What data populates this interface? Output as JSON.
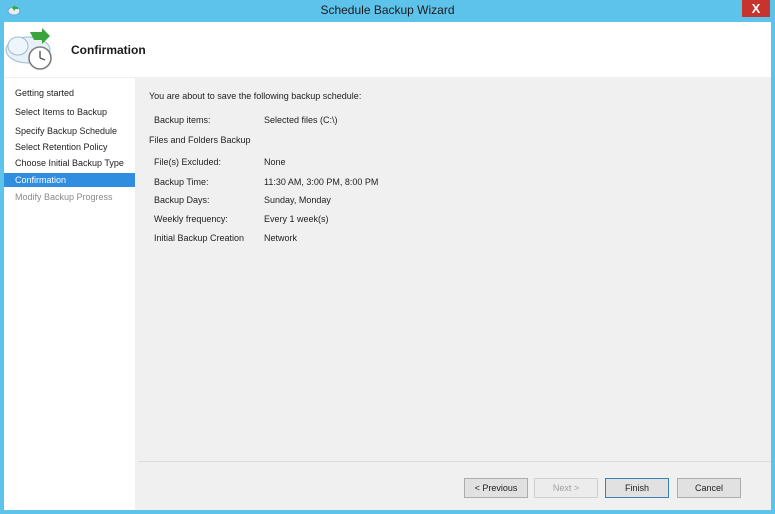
{
  "window": {
    "title": "Schedule Backup Wizard",
    "close_label": "X"
  },
  "header": {
    "title": "Confirmation"
  },
  "sidebar": {
    "items": [
      {
        "label": "Getting started",
        "state": "normal"
      },
      {
        "label": "Select Items to Backup",
        "state": "normal"
      },
      {
        "label": "Specify Backup Schedule",
        "state": "normal"
      },
      {
        "label": "Select Retention Policy",
        "state": "normal"
      },
      {
        "label": "Choose Initial Backup Type",
        "state": "normal"
      },
      {
        "label": "Confirmation",
        "state": "active"
      },
      {
        "label": "Modify Backup Progress",
        "state": "disabled"
      }
    ]
  },
  "main": {
    "intro": "You are about to save the following backup schedule:",
    "backup_items": {
      "label": "Backup items:",
      "value": "Selected files (C:\\)"
    },
    "section_title": "Files and Folders Backup",
    "details": [
      {
        "label": "File(s) Excluded:",
        "value": "None"
      },
      {
        "label": "Backup Time:",
        "value": "11:30 AM, 3:00 PM, 8:00 PM"
      },
      {
        "label": "Backup Days:",
        "value": "Sunday, Monday"
      },
      {
        "label": "Weekly frequency:",
        "value": "Every 1 week(s)"
      },
      {
        "label": "Initial Backup Creation",
        "value": "Network"
      }
    ]
  },
  "footer": {
    "previous_label": "< Previous",
    "next_label": "Next >",
    "finish_label": "Finish",
    "cancel_label": "Cancel"
  },
  "colors": {
    "titlebar": "#5ec3ea",
    "selection": "#2f8ee0",
    "close": "#c7342d"
  }
}
